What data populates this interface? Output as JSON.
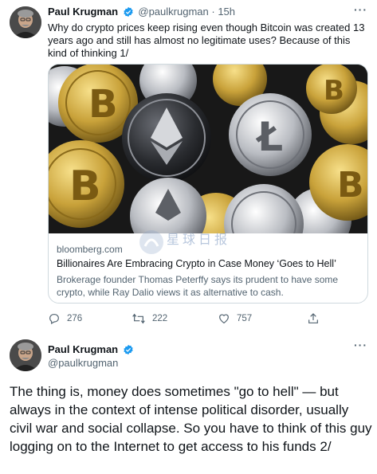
{
  "tweet1": {
    "display_name": "Paul Krugman",
    "handle": "@paulkrugman",
    "separator": "·",
    "time": "15h",
    "more": "···",
    "text": "Why do crypto prices keep rising even though Bitcoin was created 13 years ago and still has almost no legitimate uses? Because of this kind of thinking 1/",
    "card": {
      "domain": "bloomberg.com",
      "title": "Billionaires Are Embracing Crypto in Case Money ‘Goes to Hell’",
      "description": "Brokerage founder Thomas Peterffy says its prudent to have some crypto, while Ray Dalio views it as alternative to cash.",
      "watermark": "星球日报"
    },
    "actions": {
      "replies": "276",
      "retweets": "222",
      "likes": "757"
    }
  },
  "tweet2": {
    "display_name": "Paul Krugman",
    "handle": "@paulkrugman",
    "more": "···",
    "text": "The thing is, money does sometimes \"go to hell\" — but always in the context of intense political disorder, usually civil war and social collapse. So you have to think of this guy logging on to the Internet to get access to his funds 2/"
  },
  "colors": {
    "verified": "#1d9bf0",
    "secondary_text": "#536471",
    "primary_text": "#0f1419",
    "border": "#cfd9de"
  }
}
